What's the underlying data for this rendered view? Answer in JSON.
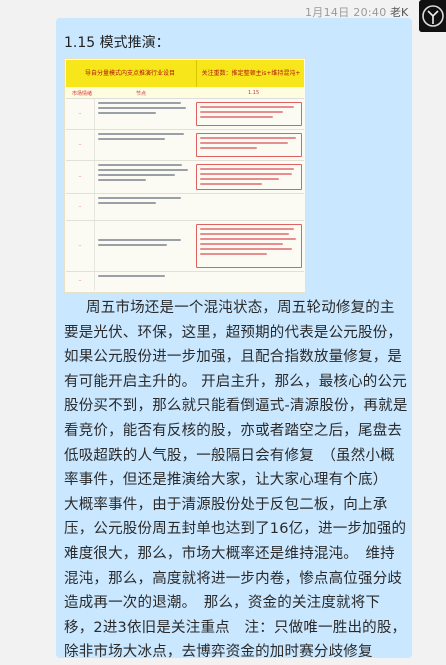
{
  "header": {
    "timestamp": "1月14日 20:40",
    "sender": "老K"
  },
  "message": {
    "heading": "1.15 模式推演：",
    "article": "周五市场还是一个混沌状态，周五轮动修复的主要是光伏、环保，这里，超预期的代表是公元股份，如果公元股份进一步加强，且配合指数放量修复，是有可能开启主升的。 开启主升，那么，最核心的公元股份买不到，那么就只能看倒逼式-清源股份，再就是看竞价，能否有反核的股，亦或者踏空之后，尾盘去低吸超跌的人气股，一般隔日会有修复　（虽然小概率事件，但还是推演给大家，让大家心理有个底）　　　大概率事件，由于清源股份处于反包二板，向上承压，公元股份周五封单也达到了16亿，进一步加强的难度很大，那么，市场大概率还是维持混沌。　维持混沌，那么，高度就将进一步内卷，惨点高位强分歧造成再一次的退潮。　那么，资金的关注度就将下移，2进3依旧是关注重点　注：只做唯一胜出的股，除非市场大冰点，去博弈资金的加时赛分歧修复"
  },
  "doc_image": {
    "header_left": "导自分量模式内支点推演行业设目",
    "header_right": "关注重数：推定整顿主is+维持混沌+",
    "col_left": "市场情绪",
    "col_mid": "节点",
    "col_right": "1.15"
  },
  "colors": {
    "bubble": "#c9e7ff",
    "doc_header": "#f7e71a",
    "annotation_red": "#e16161"
  },
  "icons": {
    "avatar": "avatar-icon"
  }
}
